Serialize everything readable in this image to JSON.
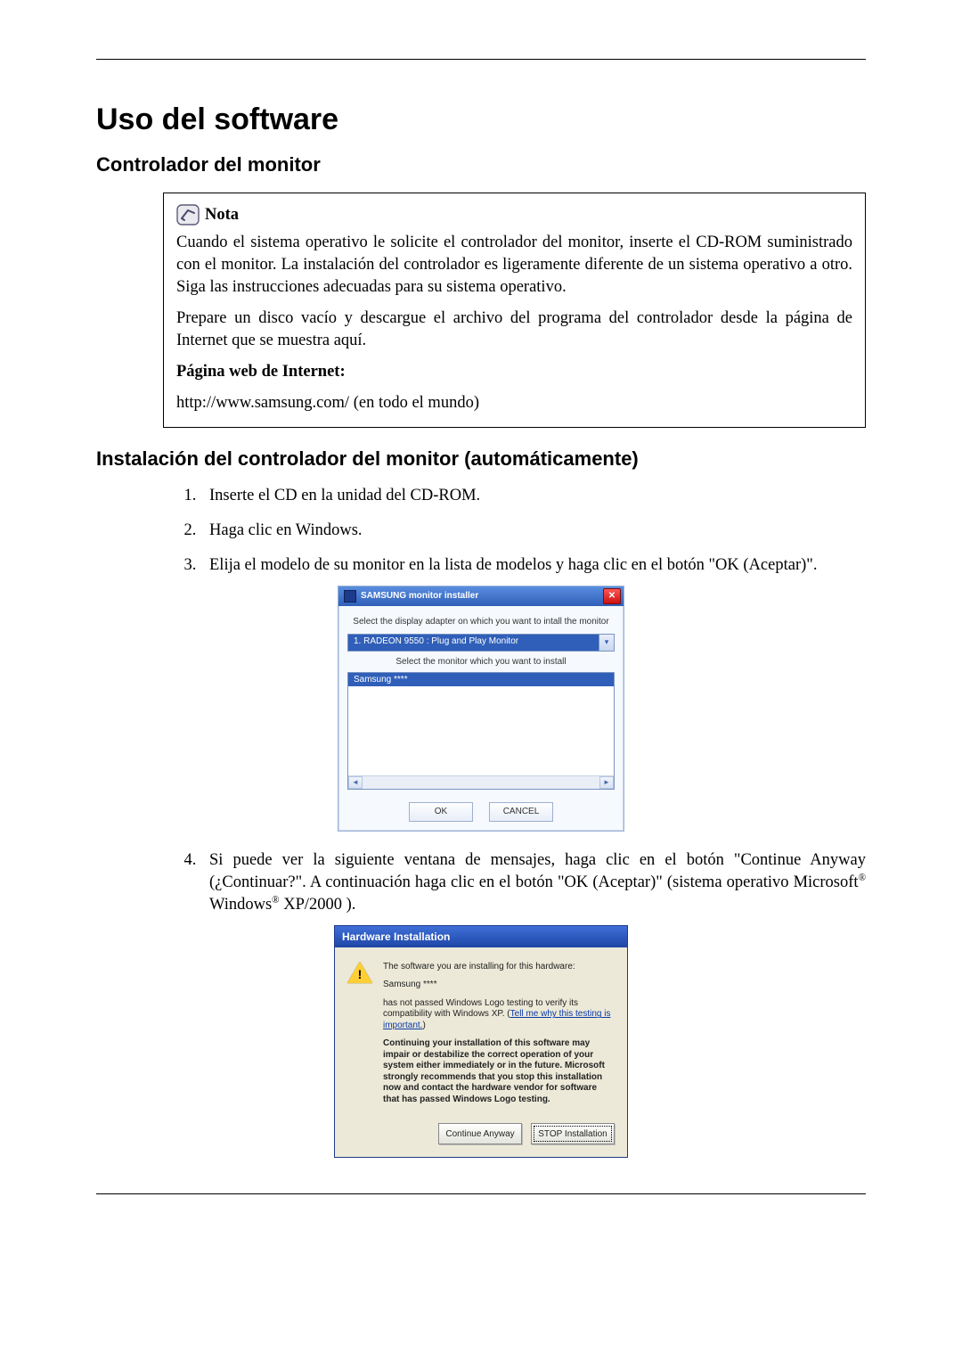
{
  "doc": {
    "title": "Uso del software",
    "section1": "Controlador del monitor",
    "section2": "Instalación del controlador del monitor (automáticamente)"
  },
  "note": {
    "label": "Nota",
    "p1": "Cuando el sistema operativo le solicite el controlador del monitor, inserte el CD-ROM suministrado con el monitor. La instalación del controlador es ligeramente diferente de un sistema operativo a otro. Siga las instrucciones adecuadas para su sistema operativo.",
    "p2": "Prepare un disco vacío y descargue el archivo del programa del controlador desde la página de Internet que se muestra aquí.",
    "p3_label": "Página web de Internet:",
    "url": "http://www.samsung.com/ (en todo el mundo)"
  },
  "steps": {
    "s1": "Inserte el CD en la unidad del CD-ROM.",
    "s2": "Haga clic en Windows.",
    "s3": "Elija el modelo de su monitor en la lista de modelos y haga clic en el botón \"OK (Aceptar)\".",
    "s4_a": "Si puede ver la siguiente ventana de mensajes, haga clic en el botón \"Continue Anyway (¿Continuar?\". A continuación haga clic en el botón \"OK (Aceptar)\" (sistema operativo Microsoft",
    "s4_b": " Windows",
    "s4_c": " XP/2000 )."
  },
  "installer": {
    "title": "SAMSUNG monitor installer",
    "instr1": "Select the display adapter on which you want to intall the monitor",
    "adapter": "1. RADEON 9550 : Plug and Play Monitor",
    "instr2": "Select the monitor which you want to install",
    "selected": "Samsung ****",
    "ok": "OK",
    "cancel": "CANCEL",
    "close_glyph": "✕"
  },
  "hw": {
    "title": "Hardware Installation",
    "line1": "The software you are installing for this hardware:",
    "device": "Samsung ****",
    "line2a": "has not passed Windows Logo testing to verify its compatibility with Windows XP. (",
    "link": "Tell me why this testing is important.",
    "line2b": ")",
    "warn": "Continuing your installation of this software may impair or destabilize the correct operation of your system either immediately or in the future. Microsoft strongly recommends that you stop this installation now and contact the hardware vendor for software that has passed Windows Logo testing.",
    "btn_continue": "Continue Anyway",
    "btn_stop": "STOP Installation"
  }
}
